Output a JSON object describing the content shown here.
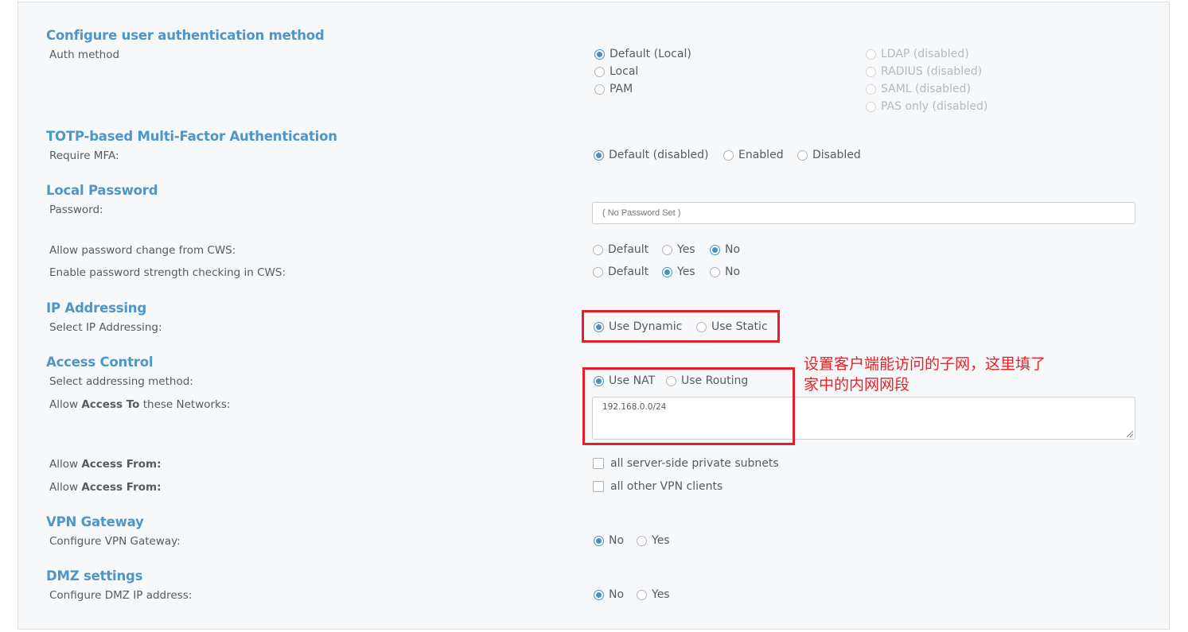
{
  "auth": {
    "title": "Configure user authentication method",
    "label": "Auth method",
    "options": {
      "default_local": "Default (Local)",
      "local": "Local",
      "pam": "PAM",
      "ldap": "LDAP (disabled)",
      "radius": "RADIUS (disabled)",
      "saml": "SAML (disabled)",
      "pas_only": "PAS only (disabled)"
    },
    "selected": "Default (Local)"
  },
  "mfa": {
    "title": "TOTP-based Multi-Factor Authentication",
    "label": "Require MFA:",
    "options": {
      "default": "Default (disabled)",
      "enabled": "Enabled",
      "disabled": "Disabled"
    },
    "selected": "Default (disabled)"
  },
  "local_password": {
    "title": "Local Password",
    "password_label": "Password:",
    "password_placeholder": "( No Password Set )",
    "change_label": "Allow password change from CWS:",
    "change_options": {
      "default": "Default",
      "yes": "Yes",
      "no": "No"
    },
    "change_selected": "No",
    "strength_label": "Enable password strength checking in CWS:",
    "strength_options": {
      "default": "Default",
      "yes": "Yes",
      "no": "No"
    },
    "strength_selected": "Yes"
  },
  "ip": {
    "title": "IP Addressing",
    "label": "Select IP Addressing:",
    "options": {
      "dynamic": "Use Dynamic",
      "static": "Use Static"
    },
    "selected": "Use Dynamic"
  },
  "access": {
    "title": "Access Control",
    "method_label": "Select addressing method:",
    "method_options": {
      "nat": "Use NAT",
      "routing": "Use Routing"
    },
    "method_selected": "Use NAT",
    "networks_label_pre": "Allow ",
    "networks_label_bold": "Access To",
    "networks_label_post": " these Networks:",
    "networks_value": "192.168.0.0/24",
    "from_label_pre": "Allow ",
    "from_label_bold": "Access From:",
    "from_private": "all server-side private subnets",
    "from_vpn": "all other VPN clients"
  },
  "gateway": {
    "title": "VPN Gateway",
    "label": "Configure VPN Gateway:",
    "options": {
      "no": "No",
      "yes": "Yes"
    },
    "selected": "No"
  },
  "dmz": {
    "title": "DMZ settings",
    "label": "Configure DMZ IP address:",
    "options": {
      "no": "No",
      "yes": "Yes"
    },
    "selected": "No"
  },
  "annotation": {
    "line1": "设置客户端能访问的子网，这里填了",
    "line2": "家中的内网网段"
  },
  "colors": {
    "title_blue": "#4d96c7",
    "radio_blue": "#4b8fc2",
    "annotation_red": "#e0202a"
  }
}
